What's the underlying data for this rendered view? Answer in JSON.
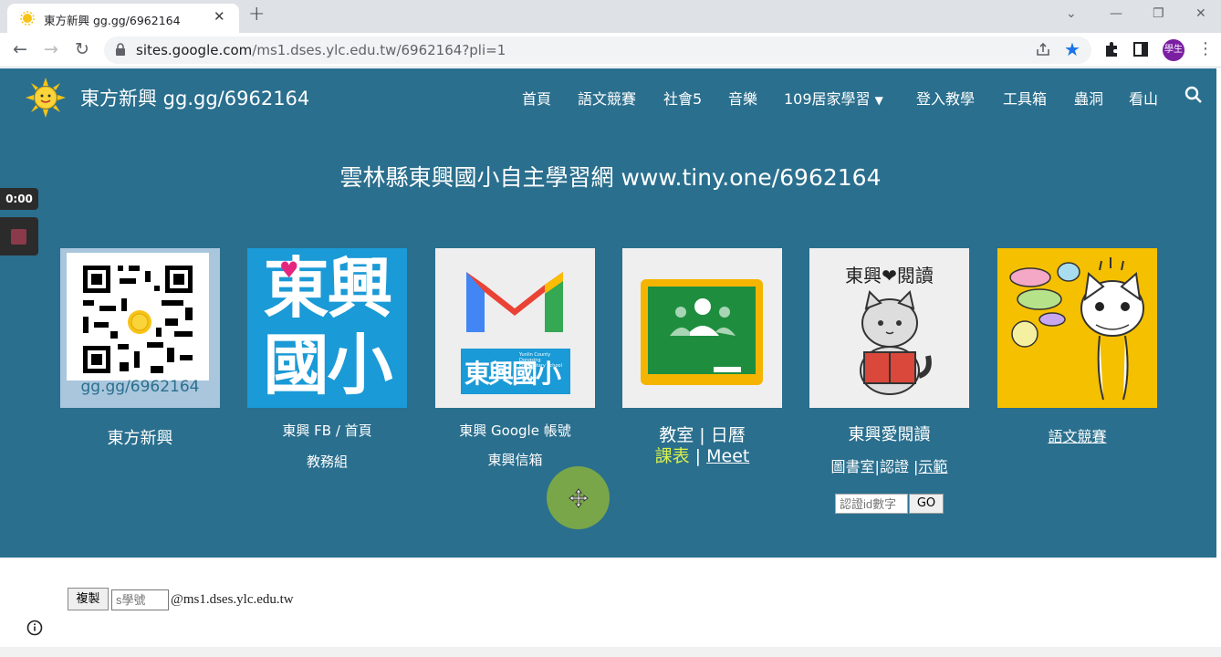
{
  "browser": {
    "tab_title": "東方新興 gg.gg/6962164",
    "url_domain": "sites.google.com",
    "url_path": "/ms1.dses.ylc.edu.tw/6962164?pli=1",
    "profile_label": "學生",
    "accent": "#1a73e8"
  },
  "site": {
    "title": "東方新興 gg.gg/6962164",
    "bg_color": "#2a6f8e",
    "nav": [
      "首頁",
      "語文競賽",
      "社會5",
      "音樂",
      "109居家學習",
      "登入教學",
      "工具箱",
      "蟲洞",
      "看山"
    ],
    "hero": "雲林縣東興國小自主學習網  www.tiny.one/6962164"
  },
  "tiles": {
    "qr": {
      "url_text": "gg.gg/6962164",
      "caption": "東方新興"
    },
    "fb": {
      "logo_top": "東興",
      "logo_bottom": "國小",
      "caption1": "東興 FB / 首頁",
      "caption2": "教務組"
    },
    "gmail": {
      "badge_text": "東興國小",
      "badge_small": "Yunlin County Dongsing Elementary School",
      "caption1": "東興 Google 帳號",
      "caption2": "東興信箱"
    },
    "classroom": {
      "caption1": "教室 | 日曆",
      "link_schedule": "課表",
      "sep": " | ",
      "link_meet": "Meet "
    },
    "reading": {
      "art_title": "東興❤閱讀",
      "caption1": "東興愛閱讀",
      "caption2_a": "圖書室|認證 |",
      "caption2_link": "示範"
    },
    "speech": {
      "caption": "語文競賽"
    }
  },
  "certify": {
    "placeholder": "認證id數字",
    "go": "GO"
  },
  "recorder": {
    "time": "0:00"
  },
  "email_helper": {
    "copy": "複製",
    "placeholder": "s學號",
    "domain": "@ms1.dses.ylc.edu.tw"
  }
}
